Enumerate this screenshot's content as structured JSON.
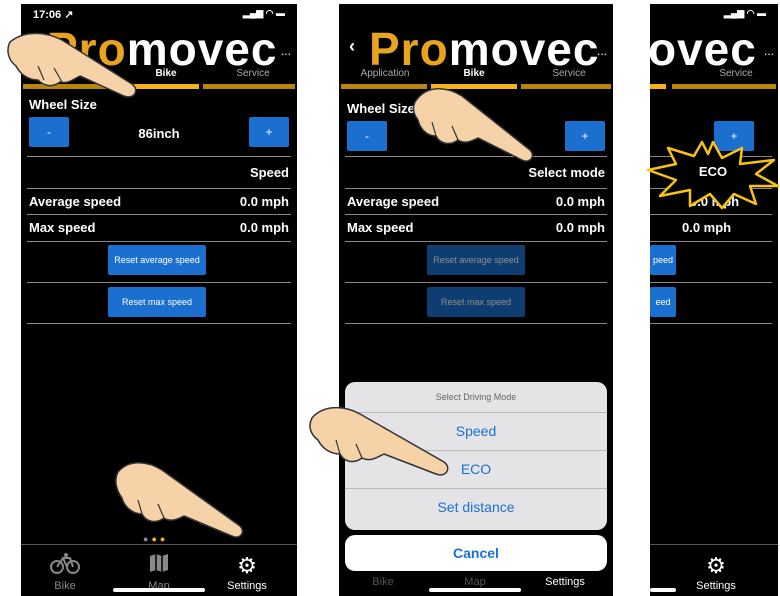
{
  "logo": {
    "pro": "Pro",
    "rest": "movec",
    "partial": "ovec",
    "more": "..."
  },
  "status": {
    "time": "17:06 ↗",
    "icons": "▂▄▆ ◠ ▬"
  },
  "tabs": {
    "application": "Application",
    "application_partial": "on",
    "bike": "Bike",
    "service": "Service"
  },
  "wheel": {
    "label": "Wheel Size",
    "value": "86inch",
    "minus": "-",
    "plus": "+"
  },
  "mode": {
    "current": "Speed",
    "select_prompt": "Select mode",
    "selected": "ECO"
  },
  "stats": {
    "avg_label": "Average speed",
    "avg_value": "0.0 mph",
    "max_label": "Max speed",
    "max_value": "0.0 mph",
    "avg_partial": "0.0 mph"
  },
  "buttons": {
    "reset_avg": "Reset average speed",
    "reset_max": "Reset max speed",
    "reset_avg_partial": "peed",
    "reset_max_partial": "eed"
  },
  "nav": {
    "bike": "Bike",
    "map": "Map",
    "settings": "Settings"
  },
  "sheet": {
    "title": "Select Driving Mode",
    "options": [
      "Speed",
      "ECO",
      "Set distance"
    ],
    "cancel": "Cancel"
  },
  "colors": {
    "accent": "#f5b21b",
    "button": "#1b6fcf",
    "ios_blue": "#1a6fd6",
    "burst": "#f7c312"
  },
  "icons": {
    "bike": "bicycle-icon",
    "map": "map-icon",
    "settings": "gear-icon",
    "back": "back-chevron-icon"
  }
}
